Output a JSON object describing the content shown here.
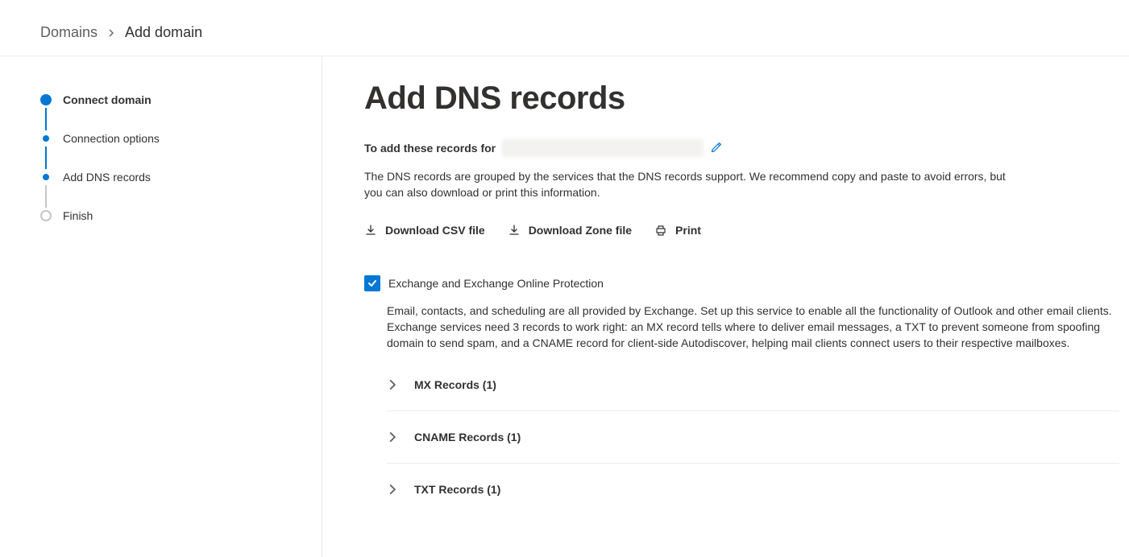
{
  "breadcrumb": {
    "root": "Domains",
    "current": "Add domain"
  },
  "steps": [
    {
      "label": "Connect domain",
      "style": "large",
      "bold": true
    },
    {
      "label": "Connection options",
      "style": "small",
      "bold": false
    },
    {
      "label": "Add DNS records",
      "style": "small",
      "bold": false
    },
    {
      "label": "Finish",
      "style": "ring",
      "bold": false
    }
  ],
  "page": {
    "title": "Add DNS records",
    "subtitle_lead": "To add these records for",
    "description": "The DNS records are grouped by the services that the DNS records support. We recommend copy and paste to avoid errors, but you can also download or print this information."
  },
  "actions": {
    "download_csv": "Download CSV file",
    "download_zone": "Download Zone file",
    "print": "Print"
  },
  "service": {
    "checkbox_label": "Exchange and Exchange Online Protection",
    "checked": true,
    "description": "Email, contacts, and scheduling are all provided by Exchange. Set up this service to enable all the functionality of Outlook and other email clients. Exchange services need 3 records to work right: an MX record tells where to deliver email messages, a TXT to prevent someone from spoofing domain to send spam, and a CNAME record for client-side Autodiscover, helping mail clients connect users to their respective mailboxes."
  },
  "records": [
    {
      "title": "MX Records (1)"
    },
    {
      "title": "CNAME Records (1)"
    },
    {
      "title": "TXT Records (1)"
    }
  ]
}
